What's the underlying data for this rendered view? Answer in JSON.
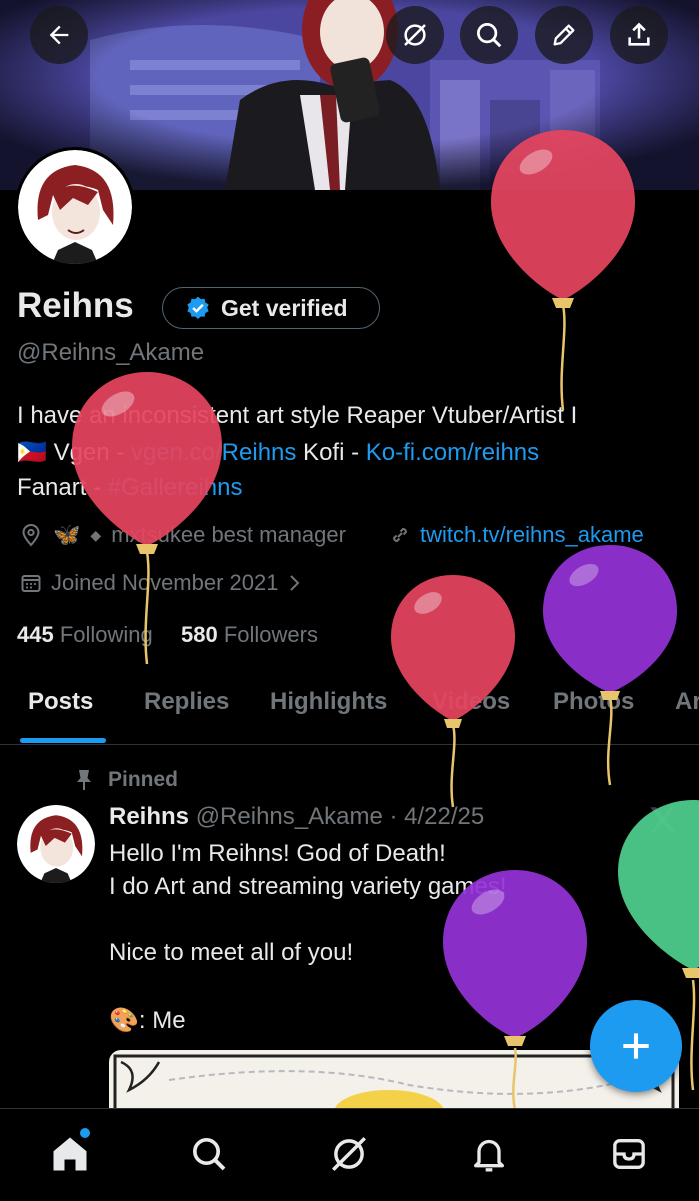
{
  "profile": {
    "name": "Reihns",
    "verify_label": "Get verified",
    "handle": "@Reihns_Akame",
    "bio": {
      "line1": "I have an inconsistent art style Reaper Vtuber/Artist I",
      "line2_flag": "🇵🇭",
      "line2_vgen_label": "Vgen - ",
      "line2_vgen_link": "vgen.co/Reihns",
      "line2_kofi_label": " Kofi - ",
      "line2_kofi_link": "Ko-fi.com/reihns",
      "line3_label": "Fanart - ",
      "line3_hashtag": "#Gallereihns"
    },
    "location": "mxtsukee best manager",
    "location_emoji": "🦋",
    "website": "twitch.tv/reihns_akame",
    "joined": "Joined November 2021",
    "following_count": "445",
    "following_label": "Following",
    "followers_count": "580",
    "followers_label": "Followers"
  },
  "tabs": [
    "Posts",
    "Replies",
    "Highlights",
    "Videos",
    "Photos",
    "Ar"
  ],
  "pinned_post": {
    "pinned_label": "Pinned",
    "author_name": "Reihns",
    "author_handle": "@Reihns_Akame",
    "date": "· 4/22/25",
    "lines": [
      "Hello I'm Reihns! God of Death!",
      "I do Art and streaming variety games!",
      "Nice to meet all of you!"
    ],
    "art_emoji": "🎨",
    "art_text": ": Me"
  },
  "colors": {
    "accent": "#1d9bf0",
    "background": "#000000",
    "text_primary": "#e7e9ea",
    "text_secondary": "#71767b",
    "balloon_red": "#e5455f",
    "balloon_purple": "#9333d6",
    "balloon_green": "#4fd08e"
  },
  "icons": {
    "top_bar": [
      "back-arrow-icon",
      "grok-icon",
      "search-icon",
      "edit-pencil-icon",
      "share-icon"
    ],
    "bottom_nav": [
      "home-icon",
      "search-icon",
      "grok-icon",
      "bell-icon",
      "mail-icon"
    ],
    "fab": "plus-icon"
  }
}
